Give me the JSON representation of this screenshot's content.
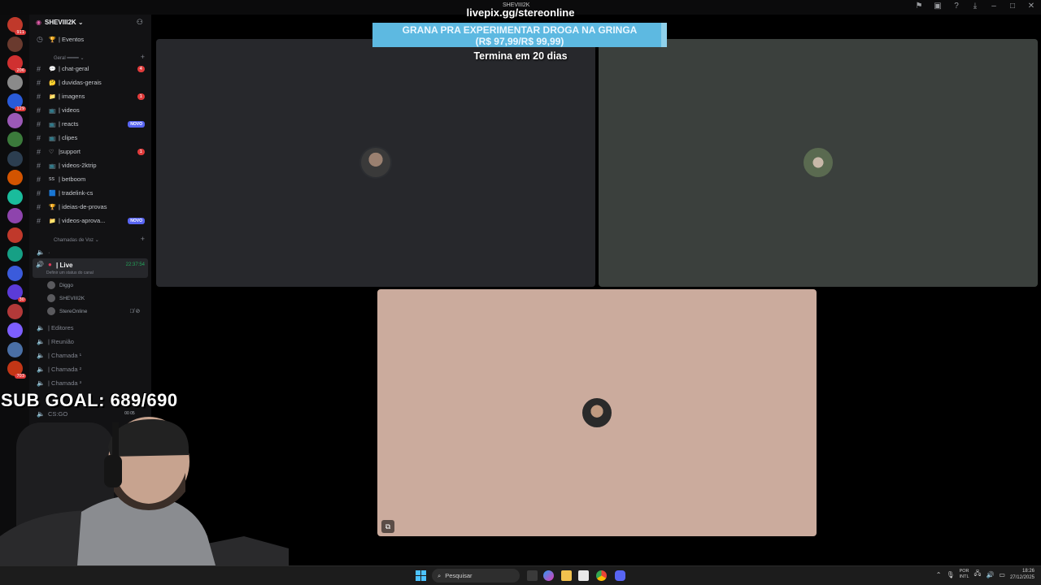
{
  "titlebar": {
    "user": "SHEVIII2K",
    "icons": [
      "flag-icon",
      "screen-icon",
      "help-icon",
      "download-icon",
      "minimize-icon",
      "maximize-icon",
      "close-icon"
    ]
  },
  "server": {
    "name": "SHEVIII2K",
    "events_label": "| Eventos",
    "category_text": "Geral",
    "channels": [
      {
        "emoji": "💬",
        "label": "| chat-geral",
        "badge": "4"
      },
      {
        "emoji": "🤔",
        "label": "| duvidas-gerais",
        "badge": ""
      },
      {
        "emoji": "📁",
        "label": "| imagens",
        "badge": "1"
      },
      {
        "emoji": "📺",
        "label": "| videos",
        "badge": ""
      },
      {
        "emoji": "📺",
        "label": "| reacts",
        "badge": "NOVO"
      },
      {
        "emoji": "📺",
        "label": "| clipes",
        "badge": ""
      },
      {
        "emoji": "♡",
        "label": "|support",
        "badge": "1"
      },
      {
        "emoji": "📺",
        "label": "| videos-2ktrip",
        "badge": ""
      },
      {
        "emoji": "ss",
        "label": "| betboom",
        "badge": ""
      },
      {
        "emoji": "🟦",
        "label": "| tradelink-cs",
        "badge": ""
      },
      {
        "emoji": "🏆",
        "label": "| ideias-de-provas",
        "badge": ""
      },
      {
        "emoji": "📁",
        "label": "| videos-aprova...",
        "badge": "NOVO"
      }
    ],
    "voice_category": "Chamadas de Voz",
    "voice_live": {
      "name": "| Live",
      "time": "22:37:54",
      "status": "Definir um status do canal"
    },
    "members": [
      "Diggo",
      "SHEVIII2K",
      "StereOnline"
    ],
    "voice_channels": [
      "| Editores",
      "| Reunião",
      "| Chamada ¹",
      "| Chamada ²",
      "| Chamada ³"
    ],
    "csgo": {
      "label": "CS:GO",
      "counts": "00 05"
    }
  },
  "rail_badges": [
    "911",
    "",
    "206",
    "",
    "129",
    "",
    "",
    "",
    "",
    "",
    "",
    "",
    "",
    "",
    "30",
    "",
    "",
    "",
    "703"
  ],
  "overlay": {
    "link": "livepix.gg/stereonline",
    "banner_line1": "GRANA PRA EXPERIMENTAR DROGA NA GRINGA",
    "banner_line2": "(R$ 97,99/R$ 99,99)",
    "progress": 0.98,
    "sub": "Termina em 20 dias",
    "goal": "SUB GOAL: 689/690"
  },
  "colors": {
    "tile1": "#27282c",
    "tile2": "#3b403d",
    "tile3": "#cbab9d",
    "banner": "#8fd0ea",
    "accent": "#5865f2"
  },
  "taskbar": {
    "search_placeholder": "Pesquisar",
    "lang1": "POR",
    "lang2": "INTL",
    "time": "18:26",
    "date": "27/12/2025"
  }
}
